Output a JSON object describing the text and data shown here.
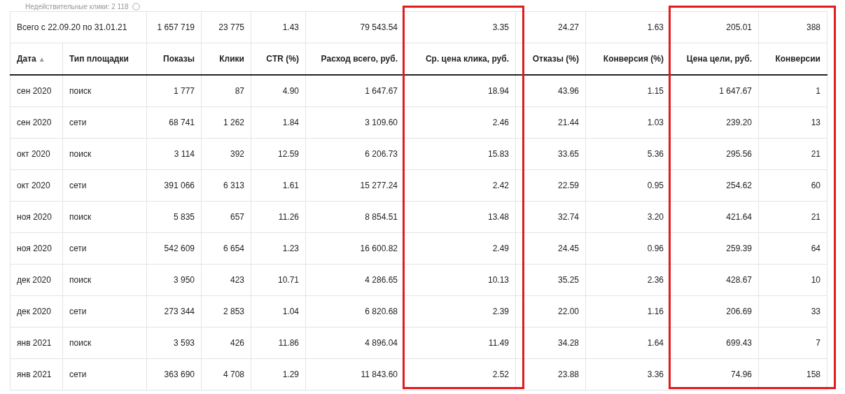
{
  "caption": {
    "text": "Недействительные клики: 2 118"
  },
  "summary": {
    "label": "Всего с 22.09.20 по 31.01.21",
    "values": [
      "1 657 719",
      "23 775",
      "1.43",
      "79 543.54",
      "3.35",
      "24.27",
      "1.63",
      "205.01",
      "388"
    ]
  },
  "columns": [
    {
      "label": "Дата",
      "sort_indicator": "▲",
      "highlighted": false
    },
    {
      "label": "Тип площадки",
      "highlighted": false
    },
    {
      "label": "Показы",
      "highlighted": false
    },
    {
      "label": "Клики",
      "highlighted": false
    },
    {
      "label": "CTR (%)",
      "highlighted": false
    },
    {
      "label": "Расход всего, руб.",
      "highlighted": false
    },
    {
      "label": "Ср. цена клика, руб.",
      "highlighted": true
    },
    {
      "label": "Отказы (%)",
      "highlighted": false
    },
    {
      "label": "Конверсия (%)",
      "highlighted": false
    },
    {
      "label": "Цена цели, руб.",
      "highlighted": true
    },
    {
      "label": "Конверсии",
      "highlighted": true
    }
  ],
  "rows": [
    [
      "сен 2020",
      "поиск",
      "1 777",
      "87",
      "4.90",
      "1 647.67",
      "18.94",
      "43.96",
      "1.15",
      "1 647.67",
      "1"
    ],
    [
      "сен 2020",
      "сети",
      "68 741",
      "1 262",
      "1.84",
      "3 109.60",
      "2.46",
      "21.44",
      "1.03",
      "239.20",
      "13"
    ],
    [
      "окт 2020",
      "поиск",
      "3 114",
      "392",
      "12.59",
      "6 206.73",
      "15.83",
      "33.65",
      "5.36",
      "295.56",
      "21"
    ],
    [
      "окт 2020",
      "сети",
      "391 066",
      "6 313",
      "1.61",
      "15 277.24",
      "2.42",
      "22.59",
      "0.95",
      "254.62",
      "60"
    ],
    [
      "ноя 2020",
      "поиск",
      "5 835",
      "657",
      "11.26",
      "8 854.51",
      "13.48",
      "32.74",
      "3.20",
      "421.64",
      "21"
    ],
    [
      "ноя 2020",
      "сети",
      "542 609",
      "6 654",
      "1.23",
      "16 600.82",
      "2.49",
      "24.45",
      "0.96",
      "259.39",
      "64"
    ],
    [
      "дек 2020",
      "поиск",
      "3 950",
      "423",
      "10.71",
      "4 286.65",
      "10.13",
      "35.25",
      "2.36",
      "428.67",
      "10"
    ],
    [
      "дек 2020",
      "сети",
      "273 344",
      "2 853",
      "1.04",
      "6 820.68",
      "2.39",
      "22.00",
      "1.16",
      "206.69",
      "33"
    ],
    [
      "янв 2021",
      "поиск",
      "3 593",
      "426",
      "11.86",
      "4 896.04",
      "11.49",
      "34.28",
      "1.64",
      "699.43",
      "7"
    ],
    [
      "янв 2021",
      "сети",
      "363 690",
      "4 708",
      "1.29",
      "11 843.60",
      "2.52",
      "23.88",
      "3.36",
      "74.96",
      "158"
    ]
  ]
}
